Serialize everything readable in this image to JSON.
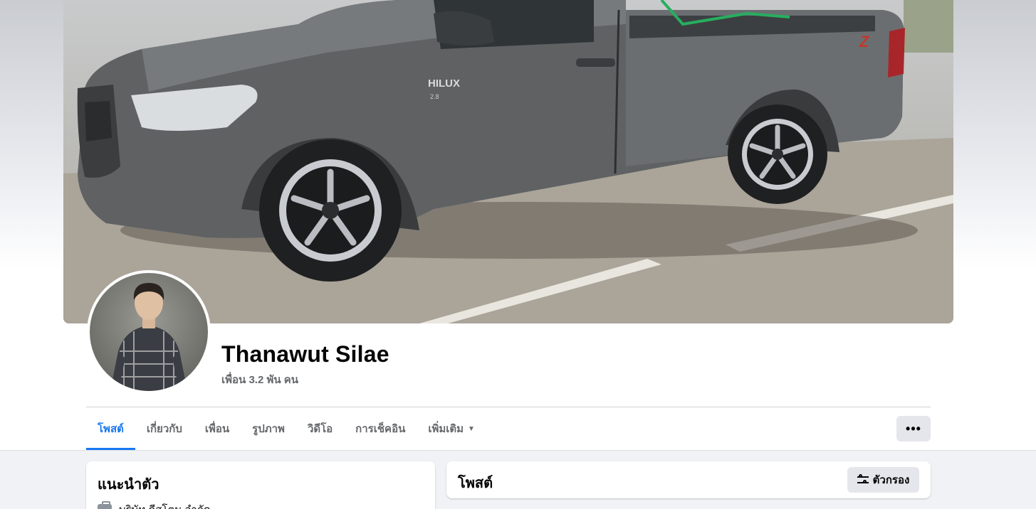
{
  "profile": {
    "name": "Thanawut Silae",
    "friends_text": "เพื่อน 3.2 พัน คน"
  },
  "tabs": [
    {
      "label": "โพสต์",
      "active": true
    },
    {
      "label": "เกี่ยวกับ",
      "active": false
    },
    {
      "label": "เพื่อน",
      "active": false
    },
    {
      "label": "รูปภาพ",
      "active": false
    },
    {
      "label": "วิดีโอ",
      "active": false
    },
    {
      "label": "การเช็คอิน",
      "active": false
    },
    {
      "label": "เพิ่มเติม",
      "active": false
    }
  ],
  "more_button": {
    "icon": "ellipsis-icon",
    "glyph": "•••"
  },
  "intro": {
    "title": "แนะนำตัว",
    "work_text": "บริษัท ดีสโตน จำกัด"
  },
  "posts": {
    "title": "โพสต์",
    "filter_label": "ตัวกรอง"
  },
  "cover_text": {
    "badge": "HILUX",
    "badge_sub": "2.8",
    "tail_badge": "Z"
  },
  "colors": {
    "accent": "#1877f2",
    "secondary_text": "#65676b",
    "button_bg": "#e4e6eb",
    "feed_bg": "#f0f2f5"
  }
}
